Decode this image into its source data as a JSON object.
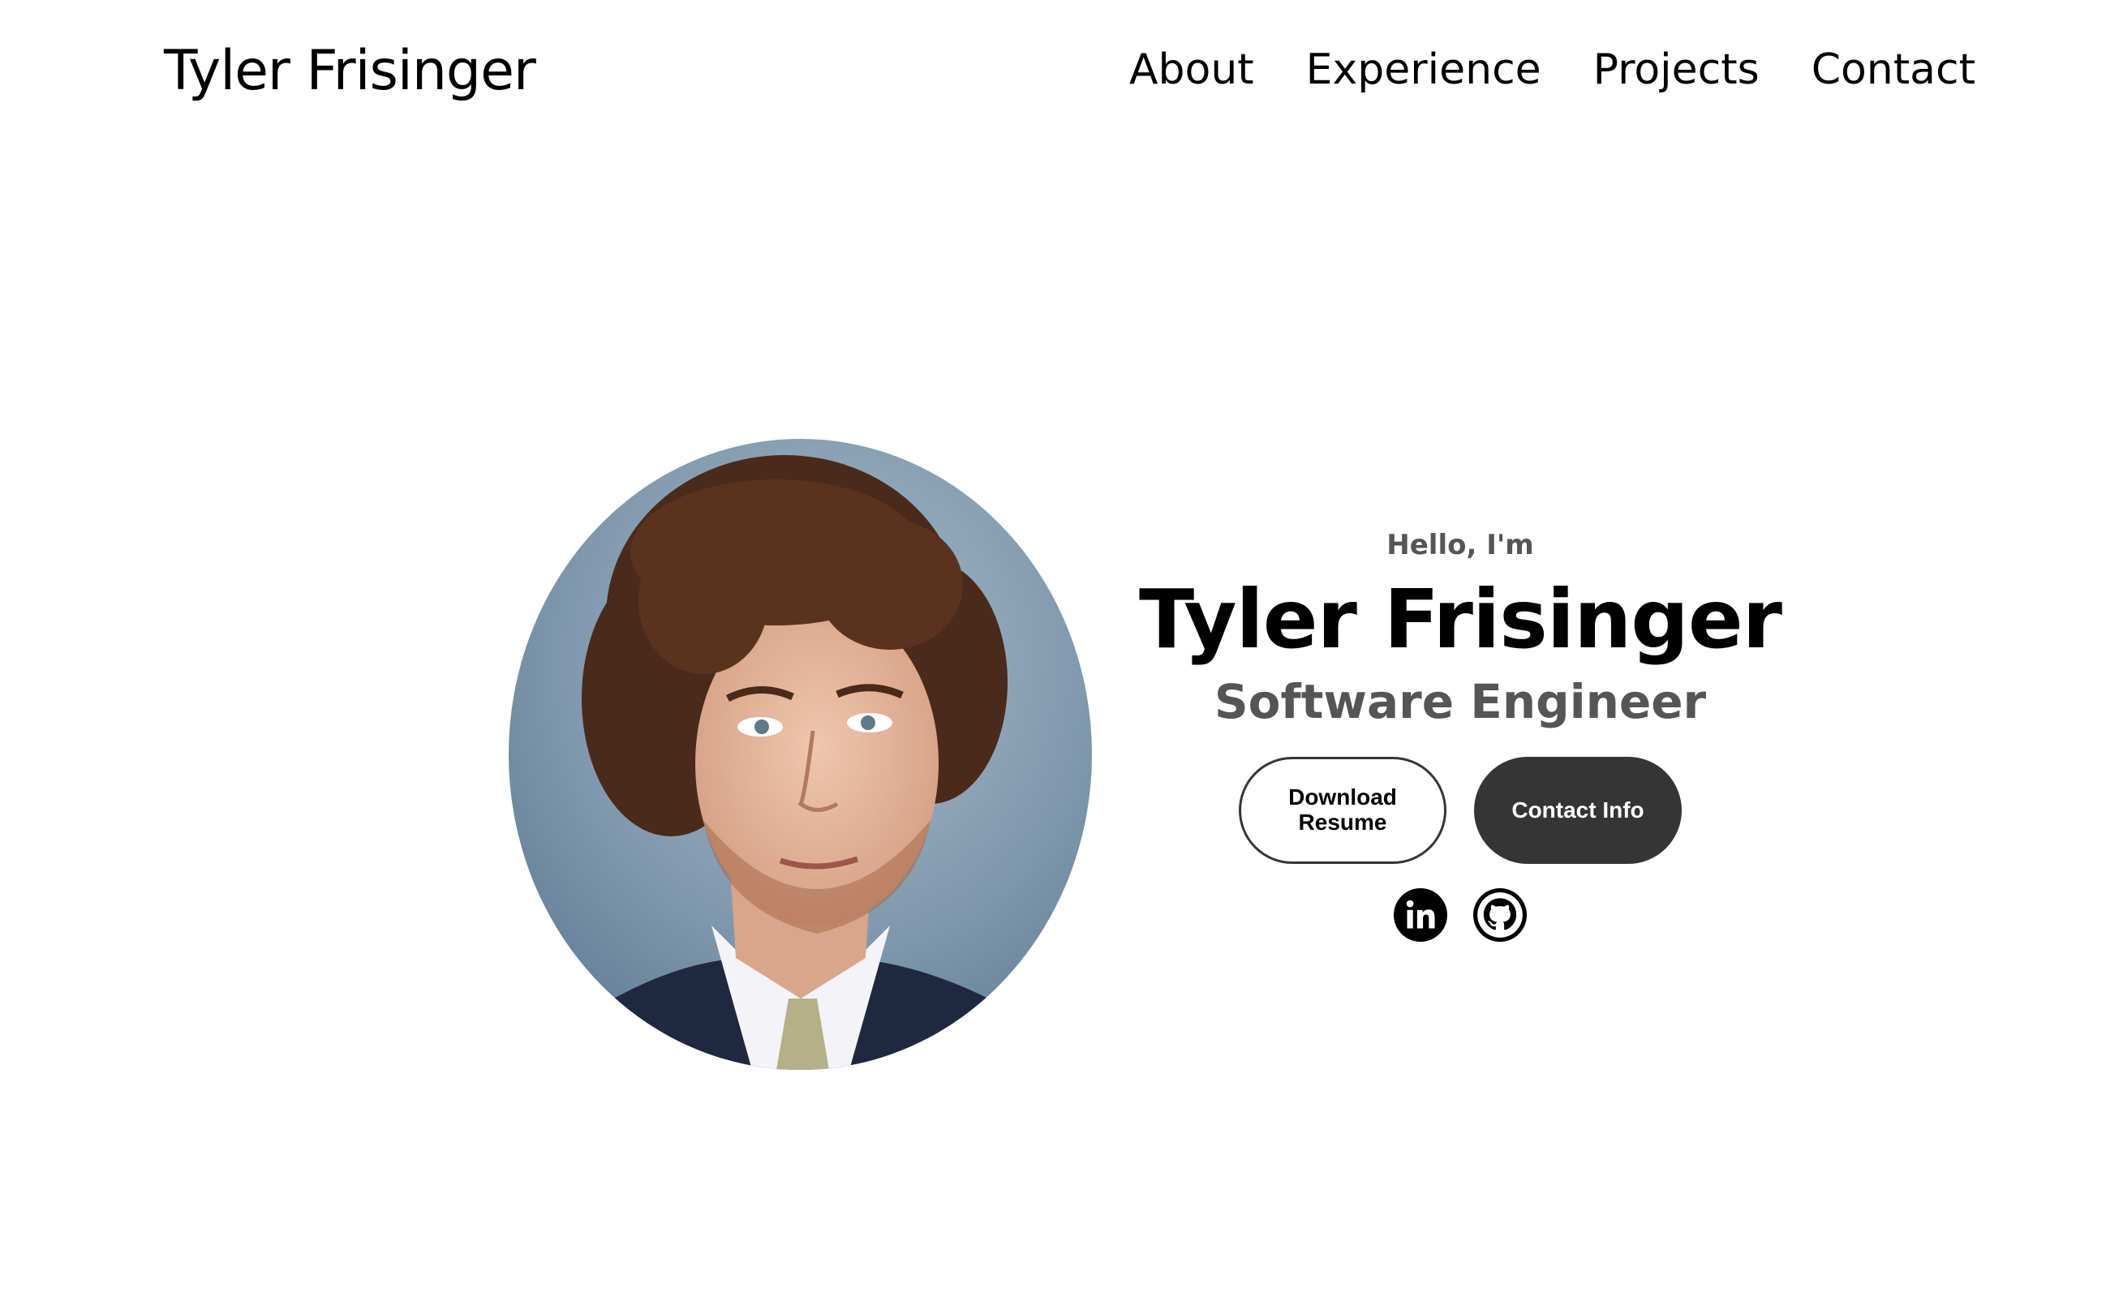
{
  "header": {
    "logo_text": "Tyler Frisinger",
    "nav": [
      {
        "label": "About"
      },
      {
        "label": "Experience"
      },
      {
        "label": "Projects"
      },
      {
        "label": "Contact"
      }
    ]
  },
  "hero": {
    "greeting": "Hello, I'm",
    "name": "Tyler Frisinger",
    "title": "Software Engineer",
    "buttons": {
      "download_resume": "Download Resume",
      "contact_info": "Contact Info"
    },
    "socials": [
      {
        "icon": "linkedin-icon"
      },
      {
        "icon": "github-icon"
      }
    ]
  },
  "colors": {
    "background": "#ffffff",
    "text": "#000000",
    "muted_text": "#555555",
    "button_dark": "#353535"
  }
}
